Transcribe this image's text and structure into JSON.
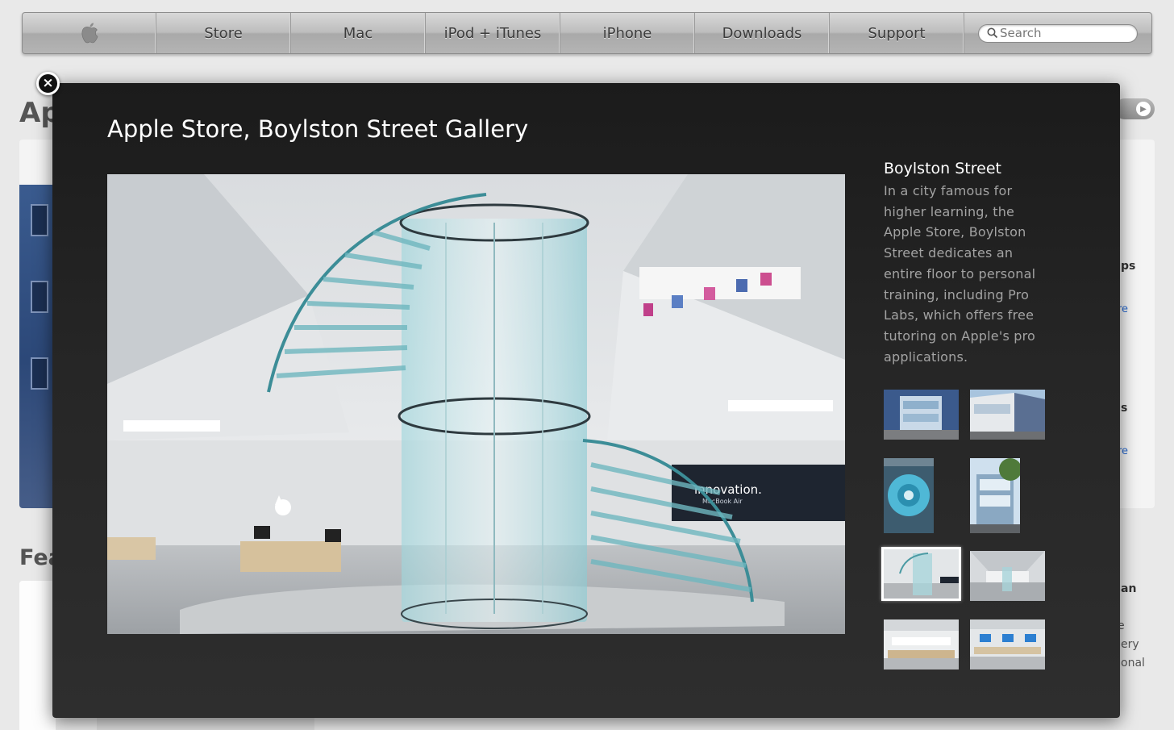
{
  "nav": {
    "items": [
      {
        "label": ""
      },
      {
        "label": "Store"
      },
      {
        "label": "Mac"
      },
      {
        "label": "iPod + iTunes"
      },
      {
        "label": "iPhone"
      },
      {
        "label": "Downloads"
      },
      {
        "label": "Support"
      }
    ],
    "search_placeholder": "Search"
  },
  "background": {
    "heading_top": "Ap",
    "heading_feature": "Fea",
    "right_fragments": [
      "ps",
      "re",
      "s",
      "re",
      "an",
      "e",
      "ery",
      "onal"
    ]
  },
  "modal": {
    "title": "Apple Store, Boylston Street Gallery",
    "close_icon": "×",
    "main_image_sign": "innovation.",
    "main_image_subsign": "MacBook Air",
    "caption_title": "Boylston Street",
    "caption_body": "In a city famous for higher learning, the Apple Store, Boylston Street dedicates an entire floor to personal training, including Pro Labs, which offers free tutoring on Apple's pro applications.",
    "thumbnails": [
      {
        "name": "storefront-front",
        "selected": false
      },
      {
        "name": "storefront-angle",
        "selected": false
      },
      {
        "name": "staircase-top-view",
        "selected": false
      },
      {
        "name": "facade-trees",
        "selected": false
      },
      {
        "name": "glass-staircase",
        "selected": true
      },
      {
        "name": "store-interior-wide",
        "selected": false
      },
      {
        "name": "genius-bar",
        "selected": false
      },
      {
        "name": "training-tables",
        "selected": false
      }
    ]
  }
}
